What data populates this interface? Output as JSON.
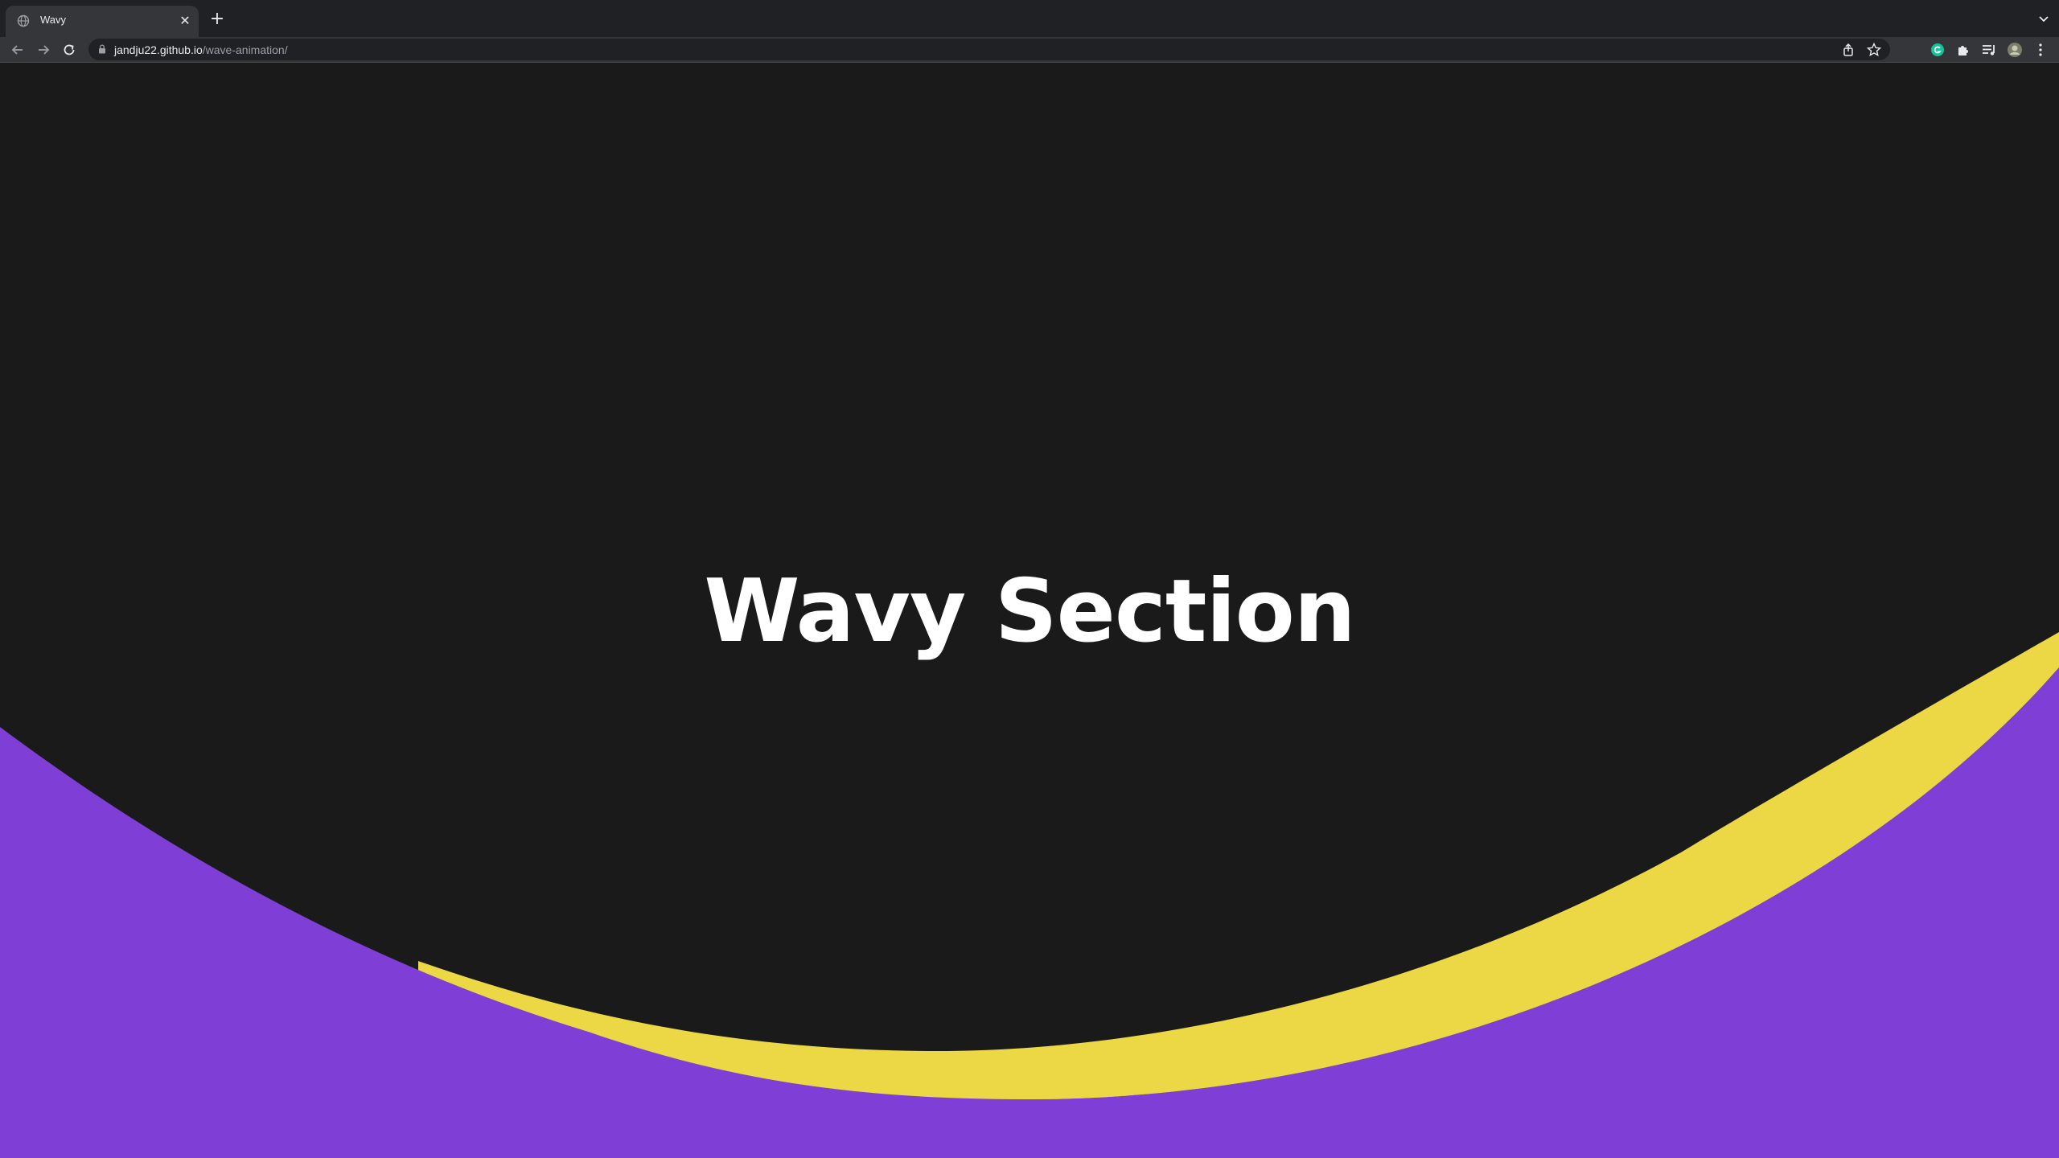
{
  "browser": {
    "tab": {
      "title": "Wavy",
      "favicon": "globe-icon"
    },
    "new_tab_label": "+",
    "close_label": "✕",
    "url": {
      "host": "jandju22.github.io",
      "path": "/wave-animation/"
    },
    "extensions": [
      "grammarly-icon",
      "puzzle-icon",
      "media-list-icon",
      "avatar"
    ]
  },
  "page": {
    "heading": "Wavy Section",
    "colors": {
      "background": "#1a1a1a",
      "wave_front": "#7f3fd6",
      "wave_back": "#ecd744",
      "heading": "#ffffff"
    }
  }
}
